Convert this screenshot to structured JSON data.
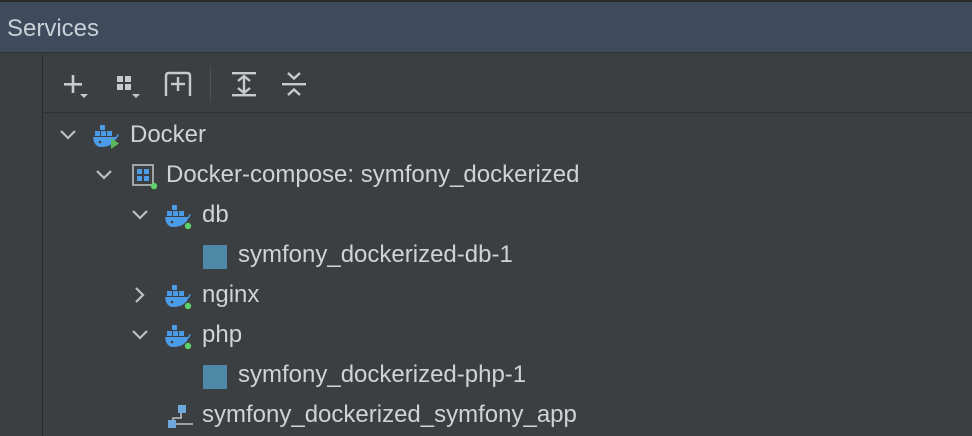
{
  "header": {
    "title": "Services"
  },
  "toolbar": {
    "buttons": [
      {
        "name": "add-service-button",
        "icon": "plus-dropdown-icon"
      },
      {
        "name": "group-by-button",
        "icon": "group-dropdown-icon"
      },
      {
        "name": "new-tab-button",
        "icon": "add-to-tab-icon"
      },
      {
        "name": "expand-all-button",
        "icon": "expand-all-icon"
      },
      {
        "name": "collapse-all-button",
        "icon": "collapse-all-icon"
      }
    ]
  },
  "tree": {
    "docker": {
      "label": "Docker",
      "icon": "docker-connected-icon",
      "expanded": true
    },
    "compose": {
      "label": "Docker-compose: symfony_dockerized",
      "icon": "compose-grid-icon",
      "expanded": true
    },
    "db": {
      "label": "db",
      "icon": "docker-service-icon",
      "expanded": true
    },
    "db_container": {
      "label": "symfony_dockerized-db-1",
      "icon": "container-square-icon"
    },
    "nginx": {
      "label": "nginx",
      "icon": "docker-service-icon",
      "expanded": false
    },
    "php": {
      "label": "php",
      "icon": "docker-service-icon",
      "expanded": true
    },
    "php_container": {
      "label": "symfony_dockerized-php-1",
      "icon": "container-square-icon"
    },
    "network": {
      "label": "symfony_dockerized_symfony_app",
      "icon": "network-icon"
    }
  },
  "colors": {
    "header_bg": "#3d4b5c",
    "panel_bg": "#3c3f41",
    "text": "#d0d3d6",
    "docker_blue": "#4c9be8",
    "status_green": "#5fd36b",
    "container_blue": "#4f87a6"
  }
}
